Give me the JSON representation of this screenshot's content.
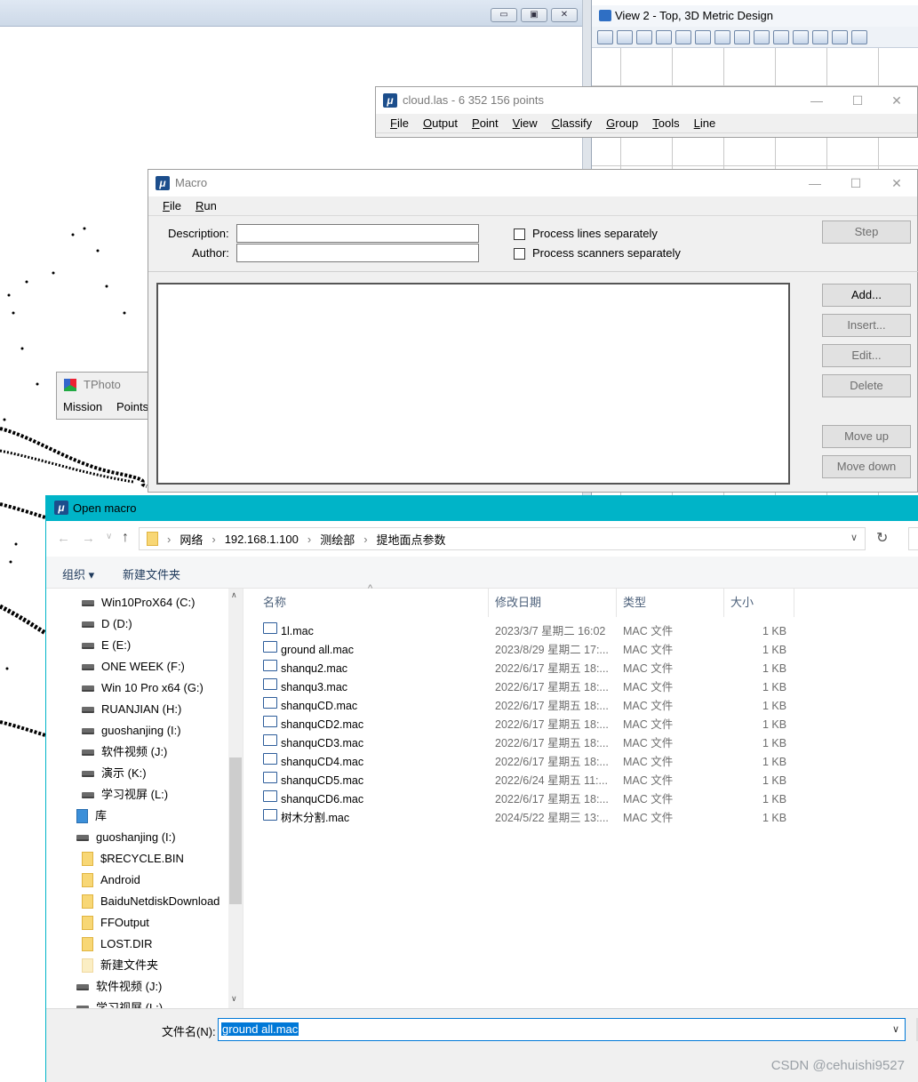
{
  "bg_window": {
    "min_label": "▭",
    "max_label": "▣",
    "close_label": "✕"
  },
  "view2": {
    "title": "View 2 - Top, 3D Metric Design"
  },
  "cloud_window": {
    "title": "cloud.las - 6 352 156 points",
    "menu": [
      "File",
      "Output",
      "Point",
      "View",
      "Classify",
      "Group",
      "Tools",
      "Line"
    ]
  },
  "macro_window": {
    "title": "Macro",
    "menu": [
      "File",
      "Run"
    ],
    "description_label": "Description:",
    "author_label": "Author:",
    "description_value": "",
    "author_value": "",
    "process_lines_label": "Process lines separately",
    "process_scanners_label": "Process scanners separately",
    "buttons": {
      "step": "Step",
      "add": "Add...",
      "insert": "Insert...",
      "edit": "Edit...",
      "delete": "Delete",
      "move_up": "Move up",
      "move_down": "Move down"
    }
  },
  "tphoto": {
    "title": "TPhoto",
    "menu": [
      "Mission",
      "Points"
    ]
  },
  "open_dialog": {
    "title": "Open macro",
    "breadcrumb": [
      "网络",
      "192.168.1.100",
      "测绘部",
      "提地面点参数"
    ],
    "organize_label": "组织 ▾",
    "new_folder_label": "新建文件夹",
    "nav_items": [
      {
        "label": "Win10ProX64 (C:)",
        "type": "drive"
      },
      {
        "label": "D (D:)",
        "type": "drive"
      },
      {
        "label": "E (E:)",
        "type": "drive"
      },
      {
        "label": "ONE WEEK (F:)",
        "type": "drive"
      },
      {
        "label": "Win 10 Pro x64 (G:)",
        "type": "drive"
      },
      {
        "label": "RUANJIAN (H:)",
        "type": "drive"
      },
      {
        "label": "guoshanjing (I:)",
        "type": "drive"
      },
      {
        "label": "软件视频 (J:)",
        "type": "drive"
      },
      {
        "label": "演示 (K:)",
        "type": "drive"
      },
      {
        "label": "学习视屏 (L:)",
        "type": "drive"
      },
      {
        "label": "库",
        "type": "library"
      },
      {
        "label": "guoshanjing (I:)",
        "type": "drive2"
      },
      {
        "label": "$RECYCLE.BIN",
        "type": "folder"
      },
      {
        "label": "Android",
        "type": "folder"
      },
      {
        "label": "BaiduNetdiskDownload",
        "type": "folder"
      },
      {
        "label": "FFOutput",
        "type": "folder"
      },
      {
        "label": "LOST.DIR",
        "type": "folder"
      },
      {
        "label": "新建文件夹",
        "type": "folder-pale"
      },
      {
        "label": "软件视频 (J:)",
        "type": "drive2"
      },
      {
        "label": "学习视屏 (L:)",
        "type": "drive2"
      }
    ],
    "columns": {
      "name": "名称",
      "date": "修改日期",
      "type": "类型",
      "size": "大小"
    },
    "files": [
      {
        "name": "1l.mac",
        "date": "2023/3/7 星期二 16:02",
        "type": "MAC 文件",
        "size": "1 KB"
      },
      {
        "name": "ground all.mac",
        "date": "2023/8/29 星期二 17:...",
        "type": "MAC 文件",
        "size": "1 KB"
      },
      {
        "name": "shanqu2.mac",
        "date": "2022/6/17 星期五 18:...",
        "type": "MAC 文件",
        "size": "1 KB"
      },
      {
        "name": "shanqu3.mac",
        "date": "2022/6/17 星期五 18:...",
        "type": "MAC 文件",
        "size": "1 KB"
      },
      {
        "name": "shanquCD.mac",
        "date": "2022/6/17 星期五 18:...",
        "type": "MAC 文件",
        "size": "1 KB"
      },
      {
        "name": "shanquCD2.mac",
        "date": "2022/6/17 星期五 18:...",
        "type": "MAC 文件",
        "size": "1 KB"
      },
      {
        "name": "shanquCD3.mac",
        "date": "2022/6/17 星期五 18:...",
        "type": "MAC 文件",
        "size": "1 KB"
      },
      {
        "name": "shanquCD4.mac",
        "date": "2022/6/17 星期五 18:...",
        "type": "MAC 文件",
        "size": "1 KB"
      },
      {
        "name": "shanquCD5.mac",
        "date": "2022/6/24 星期五 11:...",
        "type": "MAC 文件",
        "size": "1 KB"
      },
      {
        "name": "shanquCD6.mac",
        "date": "2022/6/17 星期五 18:...",
        "type": "MAC 文件",
        "size": "1 KB"
      },
      {
        "name": "树木分割.mac",
        "date": "2024/5/22 星期三 13:...",
        "type": "MAC 文件",
        "size": "1 KB"
      }
    ],
    "filename_label": "文件名(N):",
    "filename_value": "ground all.mac"
  },
  "watermark": "CSDN @cehuishi9527",
  "colors": {
    "dialog_accent": "#00b4c8",
    "selection": "#0078d7"
  }
}
